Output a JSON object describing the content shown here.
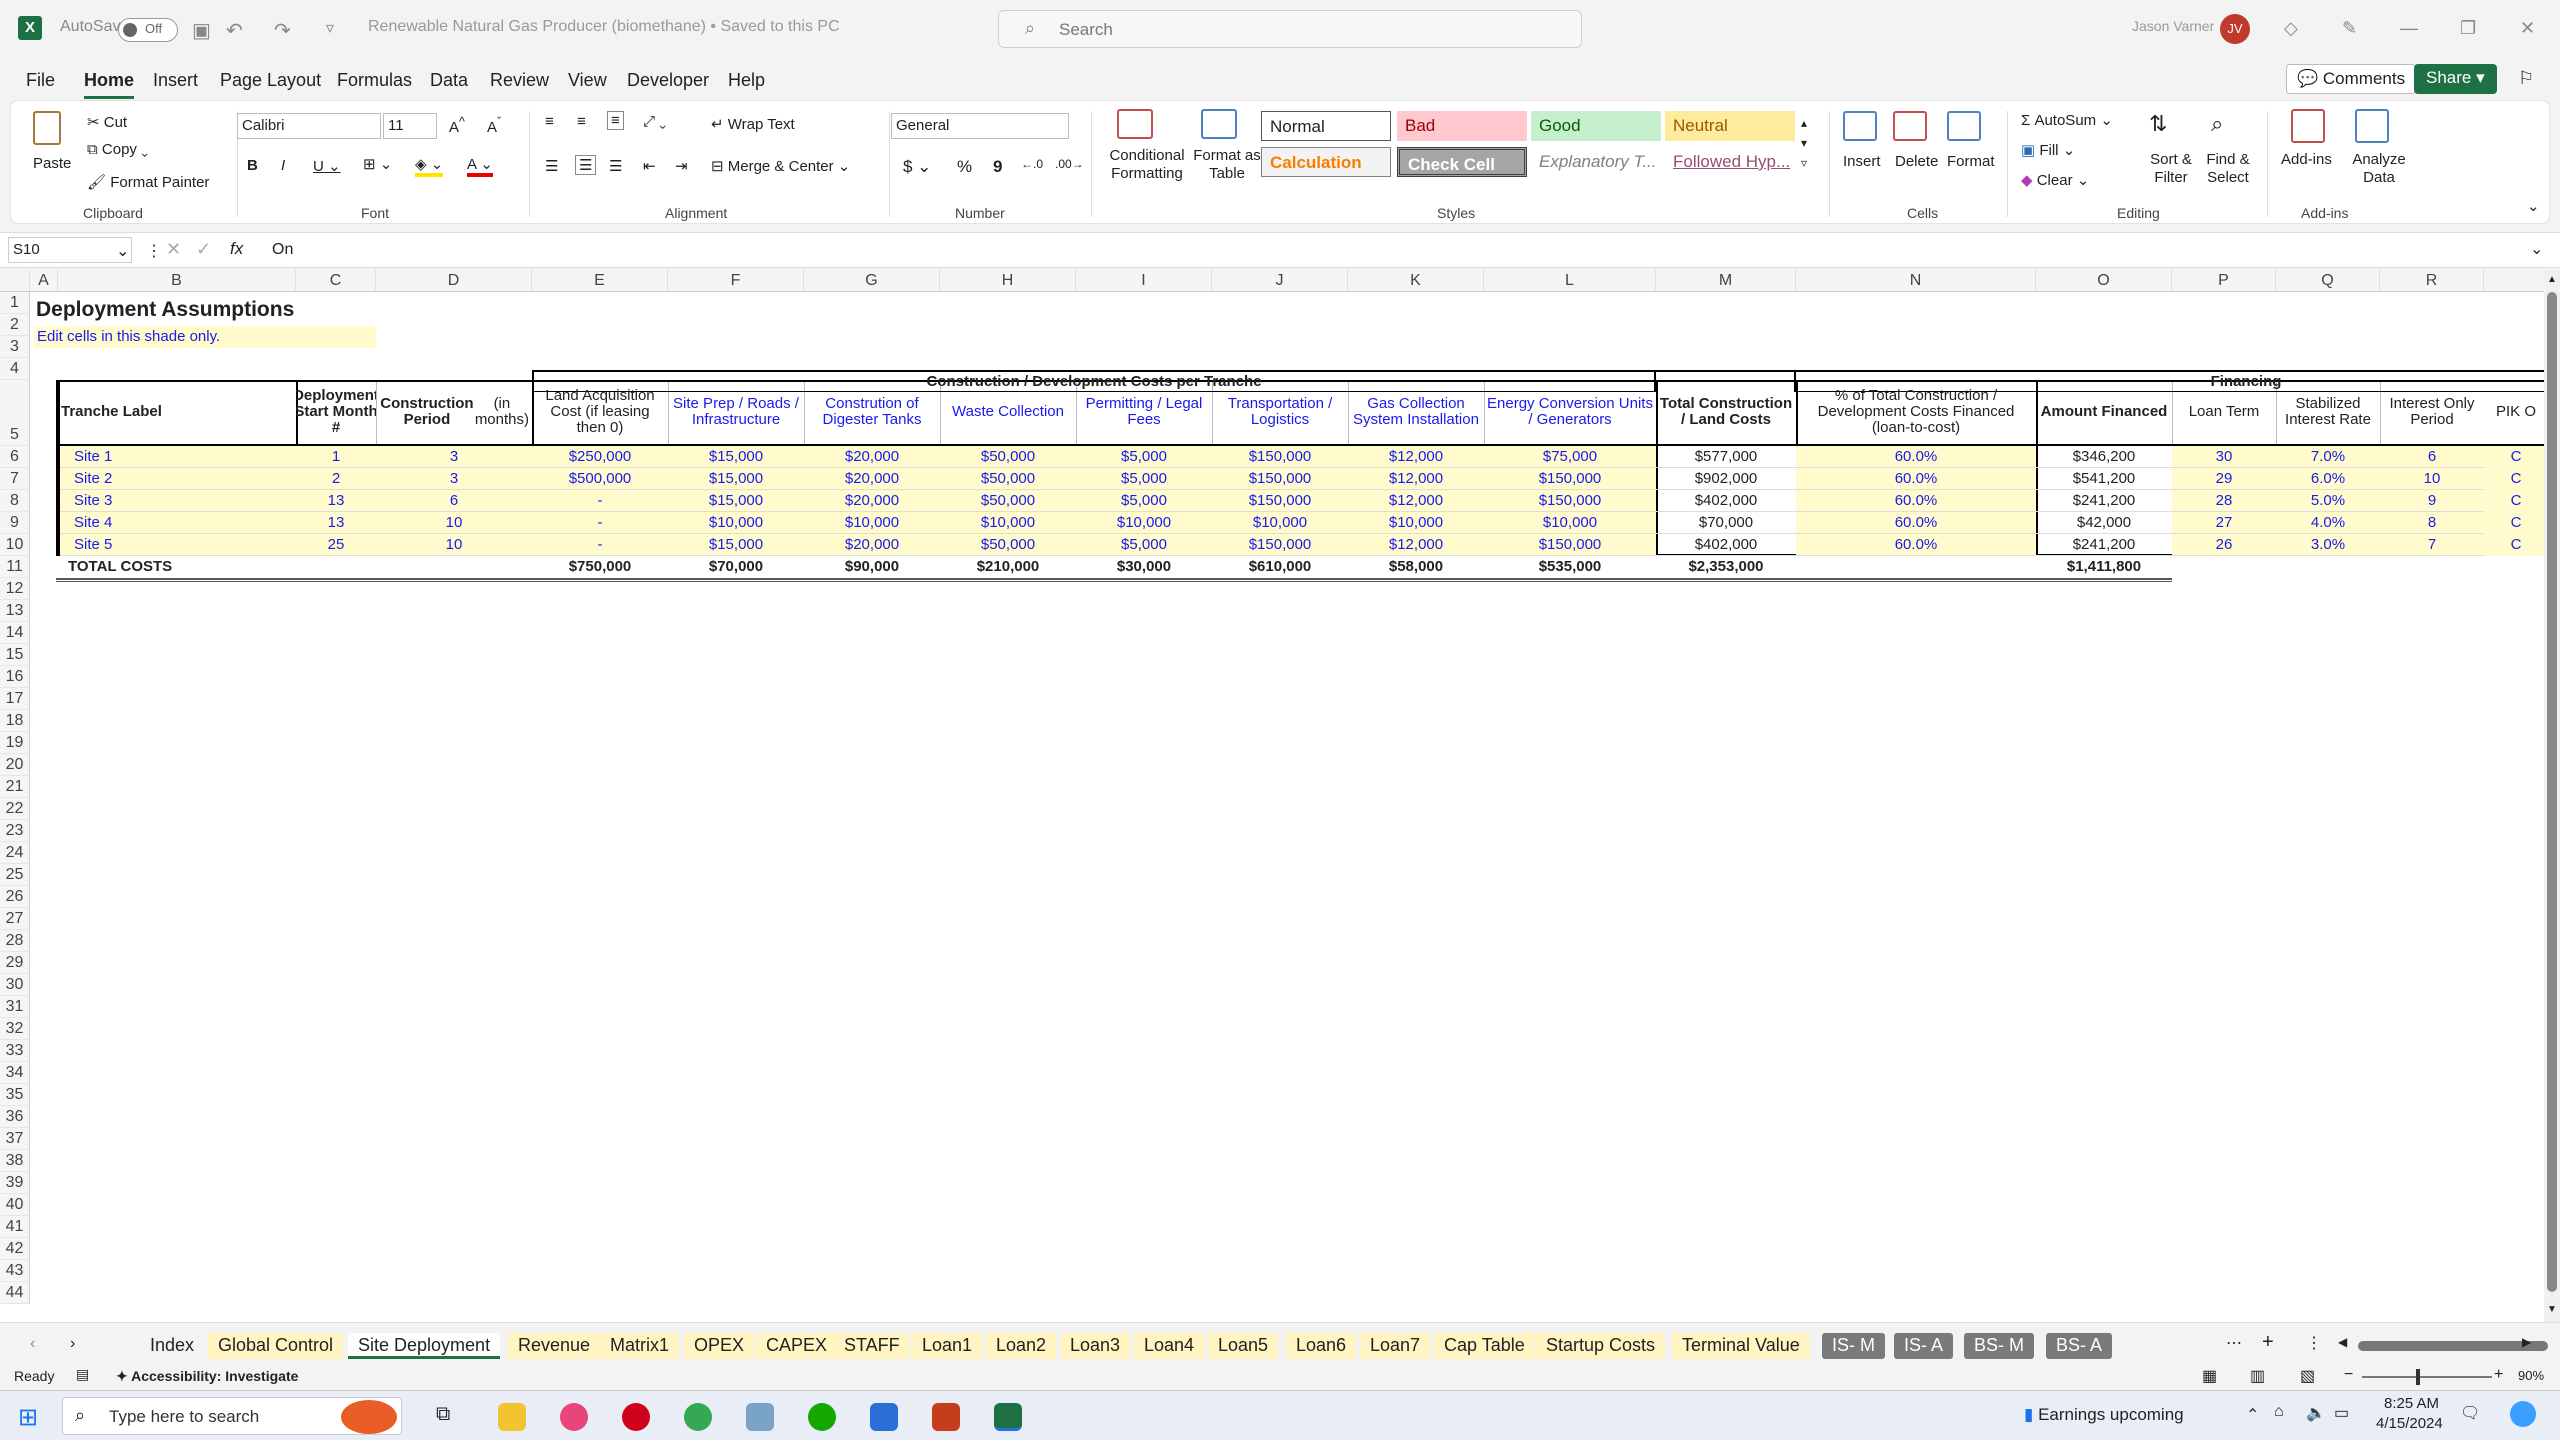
{
  "titlebar": {
    "autosave_label": "AutoSave",
    "autosave_state": "Off",
    "doc_title": "Renewable Natural Gas Producer (biomethane) • Saved to this PC",
    "search_placeholder": "Search",
    "user_name": "Jason Varner",
    "user_initials": "JV"
  },
  "menu": {
    "tabs": [
      "File",
      "Home",
      "Insert",
      "Page Layout",
      "Formulas",
      "Data",
      "Review",
      "View",
      "Developer",
      "Help"
    ],
    "active": "Home",
    "comments_label": "Comments",
    "share_label": "Share"
  },
  "ribbon": {
    "clipboard": {
      "paste": "Paste",
      "cut": "Cut",
      "copy": "Copy",
      "format_painter": "Format Painter",
      "group": "Clipboard"
    },
    "font": {
      "name": "Calibri",
      "size": "11",
      "group": "Font"
    },
    "alignment": {
      "wrap": "Wrap Text",
      "merge": "Merge & Center",
      "group": "Alignment"
    },
    "number": {
      "format": "General",
      "group": "Number"
    },
    "styles": {
      "cond_format": "Conditional Formatting",
      "format_table": "Format as Table",
      "normal": "Normal",
      "bad": "Bad",
      "good": "Good",
      "neutral": "Neutral",
      "calculation": "Calculation",
      "check_cell": "Check Cell",
      "explanatory": "Explanatory T...",
      "followed": "Followed Hyp...",
      "group": "Styles"
    },
    "cells": {
      "insert": "Insert",
      "delete": "Delete",
      "format": "Format",
      "group": "Cells"
    },
    "editing": {
      "autosum": "AutoSum",
      "fill": "Fill",
      "clear": "Clear",
      "sort": "Sort & Filter",
      "find": "Find & Select",
      "group": "Editing"
    },
    "addins": {
      "addins": "Add-ins",
      "analyze": "Analyze Data",
      "group": "Add-ins"
    }
  },
  "formula_bar": {
    "name_box": "S10",
    "fx": "fx",
    "content": "On"
  },
  "columns": [
    "A",
    "B",
    "C",
    "D",
    "E",
    "F",
    "G",
    "H",
    "I",
    "J",
    "K",
    "L",
    "M",
    "N",
    "O",
    "P",
    "Q",
    "R"
  ],
  "sheet": {
    "title": "Deployment Assumptions",
    "subtitle": "Edit cells in this shade only.",
    "group_header_construction": "Construction / Development Costs per Tranche",
    "group_header_financing": "Financing",
    "headers": {
      "tranche": "Tranche Label",
      "start": "Deployment Start Month #",
      "period_a": "Construction Period",
      "period_b": "(in months)",
      "land": "Land Acquisition Cost (if leasing then 0)",
      "siteprep": "Site Prep / Roads / Infrastructure",
      "digester": "Constrution of Digester Tanks",
      "waste": "Waste Collection",
      "permitting": "Permitting / Legal Fees",
      "transport": "Transportation / Logistics",
      "gas": "Gas Collection System Installation",
      "energy": "Energy Conversion Units / Generators",
      "total": "Total Construction / Land Costs",
      "pct": "% of Total Construction / Development Costs Financed (loan-to-cost)",
      "financed": "Amount Financed",
      "term": "Loan Term",
      "rate": "Stabilized Interest Rate",
      "io": "Interest Only Period",
      "pik": "PIK O"
    },
    "rows": [
      {
        "label": "Site 1",
        "start": "1",
        "period": "3",
        "land": "$250,000",
        "siteprep": "$15,000",
        "digester": "$20,000",
        "waste": "$50,000",
        "permitting": "$5,000",
        "transport": "$150,000",
        "gas": "$12,000",
        "energy": "$75,000",
        "total": "$577,000",
        "pct": "60.0%",
        "financed": "$346,200",
        "term": "30",
        "rate": "7.0%",
        "io": "6",
        "pik": "C"
      },
      {
        "label": "Site 2",
        "start": "2",
        "period": "3",
        "land": "$500,000",
        "siteprep": "$15,000",
        "digester": "$20,000",
        "waste": "$50,000",
        "permitting": "$5,000",
        "transport": "$150,000",
        "gas": "$12,000",
        "energy": "$150,000",
        "total": "$902,000",
        "pct": "60.0%",
        "financed": "$541,200",
        "term": "29",
        "rate": "6.0%",
        "io": "10",
        "pik": "C"
      },
      {
        "label": "Site 3",
        "start": "13",
        "period": "6",
        "land": "-",
        "siteprep": "$15,000",
        "digester": "$20,000",
        "waste": "$50,000",
        "permitting": "$5,000",
        "transport": "$150,000",
        "gas": "$12,000",
        "energy": "$150,000",
        "total": "$402,000",
        "pct": "60.0%",
        "financed": "$241,200",
        "term": "28",
        "rate": "5.0%",
        "io": "9",
        "pik": "C"
      },
      {
        "label": "Site 4",
        "start": "13",
        "period": "10",
        "land": "-",
        "siteprep": "$10,000",
        "digester": "$10,000",
        "waste": "$10,000",
        "permitting": "$10,000",
        "transport": "$10,000",
        "gas": "$10,000",
        "energy": "$10,000",
        "total": "$70,000",
        "pct": "60.0%",
        "financed": "$42,000",
        "term": "27",
        "rate": "4.0%",
        "io": "8",
        "pik": "C"
      },
      {
        "label": "Site 5",
        "start": "25",
        "period": "10",
        "land": "-",
        "siteprep": "$15,000",
        "digester": "$20,000",
        "waste": "$50,000",
        "permitting": "$5,000",
        "transport": "$150,000",
        "gas": "$12,000",
        "energy": "$150,000",
        "total": "$402,000",
        "pct": "60.0%",
        "financed": "$241,200",
        "term": "26",
        "rate": "3.0%",
        "io": "7",
        "pik": "C"
      }
    ],
    "totals": {
      "label": "TOTAL COSTS",
      "land": "$750,000",
      "siteprep": "$70,000",
      "digester": "$90,000",
      "waste": "$210,000",
      "permitting": "$30,000",
      "transport": "$610,000",
      "gas": "$58,000",
      "energy": "$535,000",
      "total": "$2,353,000",
      "financed": "$1,411,800"
    }
  },
  "sheet_tabs": [
    "Index",
    "Global Control",
    "Site Deployment",
    "Revenue",
    "Matrix1",
    "OPEX",
    "CAPEX",
    "STAFF",
    "Loan1",
    "Loan2",
    "Loan3",
    "Loan4",
    "Loan5",
    "Loan6",
    "Loan7",
    "Cap Table",
    "Startup Costs",
    "Terminal Value",
    "IS- M",
    "IS- A",
    "BS- M",
    "BS- A"
  ],
  "active_sheet": "Site Deployment",
  "status": {
    "ready": "Ready",
    "accessibility": "Accessibility: Investigate",
    "zoom": "90%"
  },
  "taskbar": {
    "search_placeholder": "Type here to search",
    "news": "Earnings upcoming",
    "time": "8:25 AM",
    "date": "4/15/2024"
  },
  "colors": {
    "excel_green": "#1e7145",
    "input_yellow": "#fffbcc",
    "input_blue": "#1a1aee"
  }
}
